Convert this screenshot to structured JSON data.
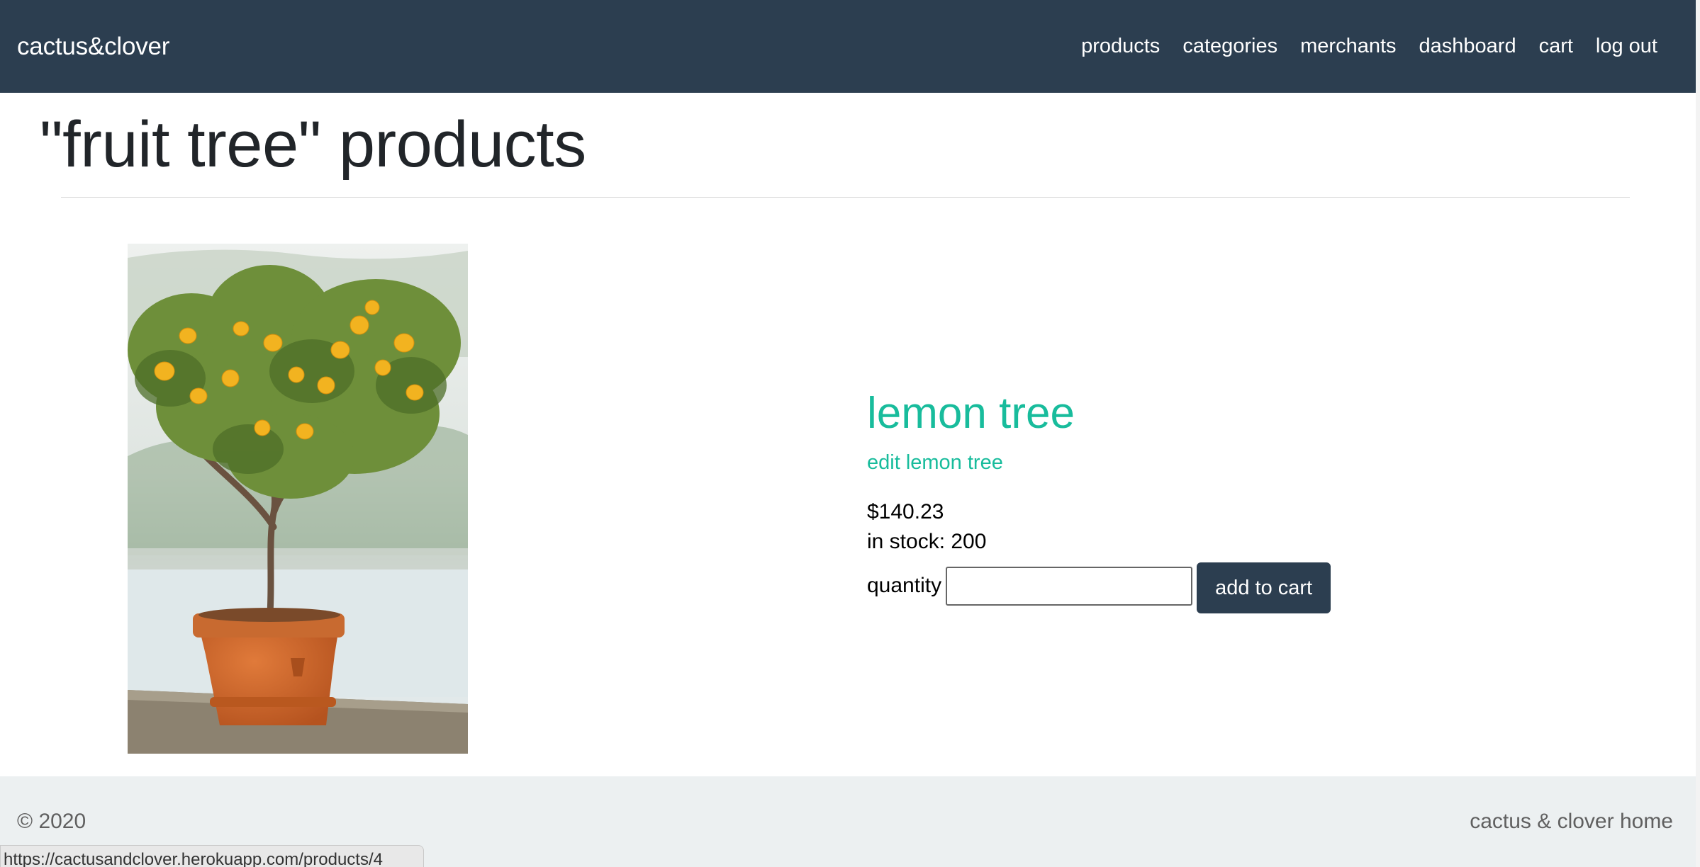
{
  "navbar": {
    "brand": "cactus&clover",
    "links": [
      {
        "label": "products"
      },
      {
        "label": "categories"
      },
      {
        "label": "merchants"
      },
      {
        "label": "dashboard"
      },
      {
        "label": "cart"
      },
      {
        "label": "log out"
      }
    ],
    "background": "#2c3e50"
  },
  "page": {
    "title": "\"fruit tree\" products"
  },
  "product": {
    "image_alt": "lemon tree in terracotta pot",
    "name": "lemon tree",
    "edit_label": "edit lemon tree",
    "price": "$140.23",
    "stock": "in stock: 200",
    "quantity_label": "quantity",
    "quantity_value": "",
    "add_button": "add to cart",
    "accent": "#18bc9c"
  },
  "footer": {
    "copyright": "© 2020",
    "home_link": "cactus & clover home"
  },
  "status_bar": {
    "url": "https://cactusandclover.herokuapp.com/products/4"
  }
}
